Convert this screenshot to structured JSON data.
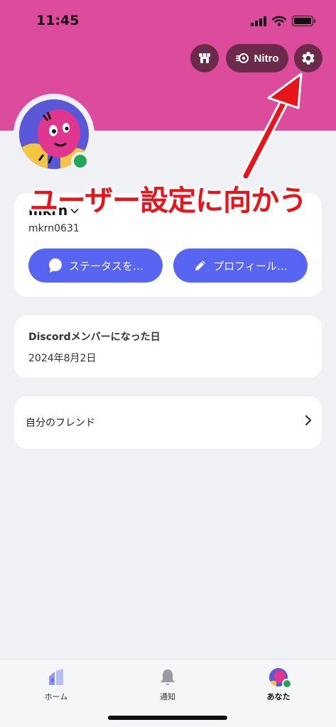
{
  "status_bar": {
    "time": "11:45"
  },
  "header": {
    "nitro_label": "Nitro",
    "shop_icon": "shop-icon",
    "settings_icon": "gear-icon"
  },
  "profile": {
    "display_name": "mkrn",
    "username": "mkrn0631",
    "status_button": "ステータスを…",
    "profile_button": "プロフィール…"
  },
  "annotation": {
    "callout": "ユーザー設定に向かう"
  },
  "member_since": {
    "label": "Discordメンバーになった日",
    "date": "2024年8月2日"
  },
  "friends": {
    "label": "自分のフレンド"
  },
  "tabbar": {
    "home": "ホーム",
    "notifications": "通知",
    "you": "あなた",
    "active": "you"
  },
  "colors": {
    "banner": "#dc4b9c",
    "accent": "#5865f2",
    "online": "#23a55a",
    "callout": "#e8141b"
  }
}
